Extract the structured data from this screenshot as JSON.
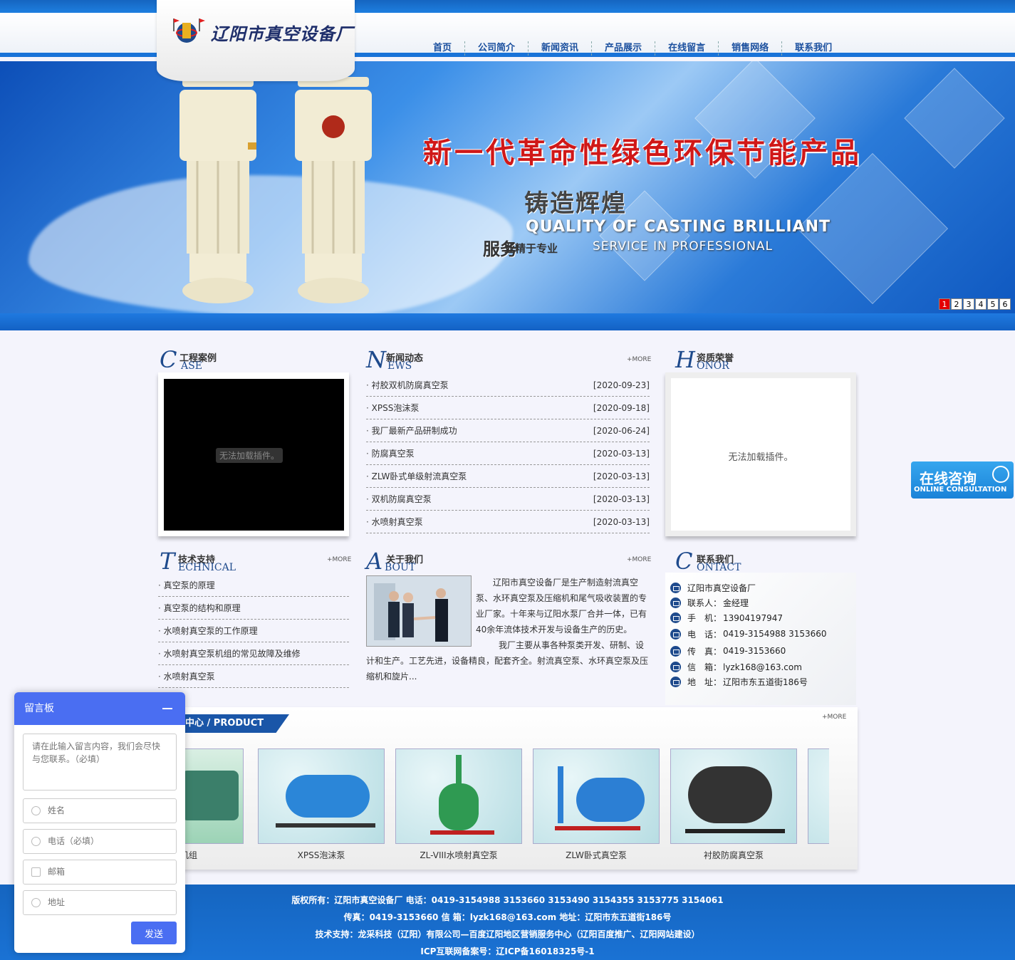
{
  "header": {
    "logo_text": "辽阳市真空设备厂",
    "nav": [
      "首页",
      "公司简介",
      "新闻资讯",
      "产品展示",
      "在线留言",
      "销售网络",
      "联系我们"
    ]
  },
  "banner": {
    "tagline": "新一代革命性绿色环保节能产品",
    "sub1": "铸造辉煌",
    "sub2": "QUALITY OF CASTING BRILLIANT",
    "sub3": "服务",
    "sub3b": "业精于专业",
    "sub4": "SERVICE IN PROFESSIONAL",
    "slides": [
      "1",
      "2",
      "3",
      "4",
      "5",
      "6"
    ],
    "active_slide": "1"
  },
  "case": {
    "letter": "C",
    "cn": "工程案例",
    "en": "ASE",
    "plugin_msg": "无法加载插件。"
  },
  "news": {
    "letter": "N",
    "cn": "新闻动态",
    "en": "EWS",
    "more": "+MORE",
    "items": [
      {
        "title": "衬胶双机防腐真空泵",
        "date": "[2020-09-23]"
      },
      {
        "title": "XPSS泡沫泵",
        "date": "[2020-09-18]"
      },
      {
        "title": "我厂最新产品研制成功",
        "date": "[2020-06-24]"
      },
      {
        "title": "防腐真空泵",
        "date": "[2020-03-13]"
      },
      {
        "title": "ZLW卧式单级射流真空泵",
        "date": "[2020-03-13]"
      },
      {
        "title": "双机防腐真空泵",
        "date": "[2020-03-13]"
      },
      {
        "title": "水喷射真空泵",
        "date": "[2020-03-13]"
      }
    ]
  },
  "honor": {
    "letter": "H",
    "cn": "资质荣誉",
    "en": "ONOR",
    "plugin_msg": "无法加载插件。"
  },
  "technical": {
    "letter": "T",
    "cn": "技术支持",
    "en": "ECHNICAL",
    "more": "+MORE",
    "items": [
      "真空泵的原理",
      "真空泵的结构和原理",
      "水喷射真空泵的工作原理",
      "水喷射真空泵机组的常见故障及维修",
      "水喷射真空泵"
    ]
  },
  "about": {
    "letter": "A",
    "cn": "关于我们",
    "en": "BOUT",
    "more": "+MORE",
    "text1": "辽阳市真空设备厂是生产制造射流真空泵、水环真空泵及压缩机和尾气吸收装置的专业厂家。十年来与辽阳水泵厂合并一体，已有40余年流体技术开发与设备生产的历史。",
    "text2": "我厂主要从事各种泵类开发、研制、设计和生产。工艺先进，设备精良，配套齐全。射流真空泵、水环真空泵及压缩机和旋片..."
  },
  "contact": {
    "letter": "C",
    "cn": "联系我们",
    "en": "ONTACT",
    "rows": [
      {
        "label": "",
        "value": "辽阳市真空设备厂"
      },
      {
        "label": "联系人：",
        "value": "金经理"
      },
      {
        "label": "手　机：",
        "value": "13904197947"
      },
      {
        "label": "电　话：",
        "value": "0419-3154988 3153660"
      },
      {
        "label": "传　真：",
        "value": "0419-3153660"
      },
      {
        "label": "信　箱：",
        "value": "lyzk168@163.com"
      },
      {
        "label": "地　址：",
        "value": "辽阳市东五道街186号"
      }
    ]
  },
  "product": {
    "tab": "中心 / PRODUCT",
    "more": "+MORE",
    "items": [
      "环泵机组",
      "XPSS泡沫泵",
      "ZL-VIII水喷射真空泵",
      "ZLW卧式真空泵",
      "衬胶防腐真空泵",
      ""
    ]
  },
  "footer": {
    "line1": "版权所有：辽阳市真空设备厂 电话：0419-3154988 3153660 3153490 3154355 3153775 3154061",
    "line2": "传真：0419-3153660 信 箱：lyzk168@163.com 地址：辽阳市东五道街186号",
    "line3": "技术支持：龙采科技（辽阳）有限公司—百度辽阳地区营销服务中心（辽阳百度推广、辽阳网站建设）",
    "line4": "ICP互联网备案号：辽ICP备16018325号-1"
  },
  "consult": {
    "cn": "在线咨询",
    "en": "ONLINE CONSULTATION"
  },
  "msgboard": {
    "title": "留言板",
    "content_placeholder": "请在此输入留言内容，我们会尽快与您联系。（必填）",
    "name_placeholder": "姓名",
    "phone_placeholder": "电话（必填）",
    "email_placeholder": "邮箱",
    "address_placeholder": "地址",
    "send": "发送"
  },
  "colors": {
    "brand_blue": "#1565c0",
    "accent_red": "#d01818",
    "board_blue": "#4a6ef2"
  }
}
